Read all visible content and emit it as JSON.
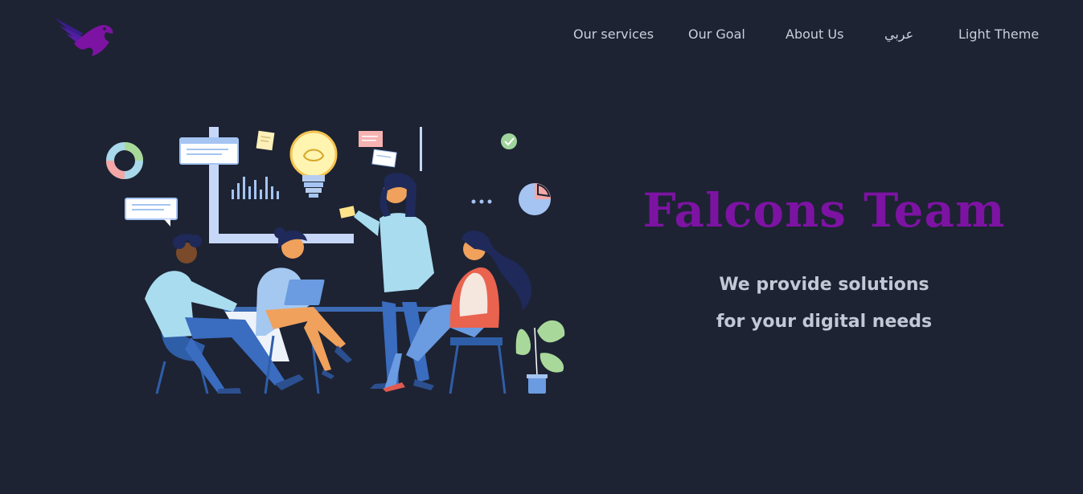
{
  "header": {
    "logo_icon": "falcon-logo-icon",
    "nav": [
      {
        "label": "Our services"
      },
      {
        "label": "Our Goal"
      },
      {
        "label": "About Us"
      },
      {
        "label": "عربي"
      },
      {
        "label": "Light Theme"
      }
    ]
  },
  "hero": {
    "title": "Falcons Team",
    "subtitle_line1": "We provide solutions",
    "subtitle_line2": "for your digital needs",
    "illustration": "team-meeting-illustration"
  },
  "colors": {
    "background": "#1d2333",
    "brand": "#7d13a3",
    "nav_text": "#c9cfdb",
    "subtitle_text": "#c2c8d6"
  }
}
